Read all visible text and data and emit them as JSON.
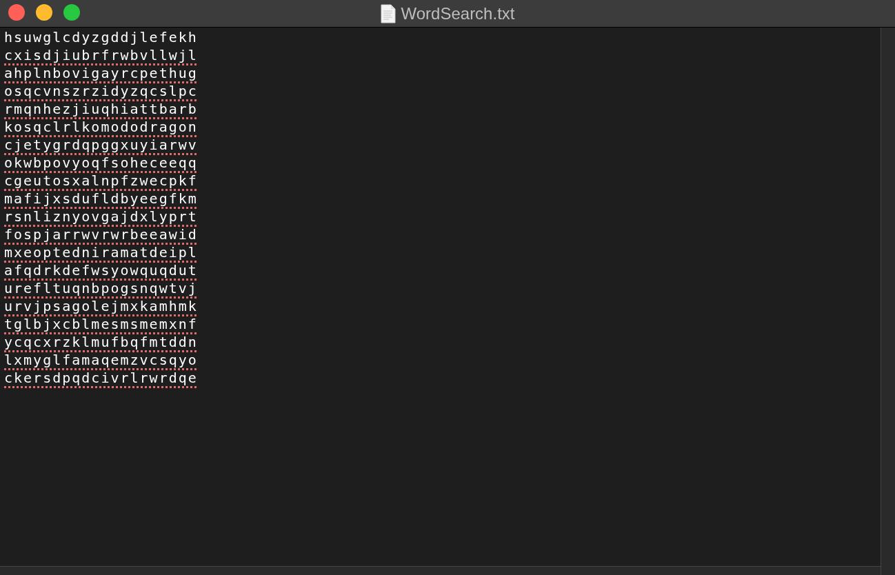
{
  "window": {
    "title": "WordSearch.txt"
  },
  "lines": [
    {
      "text": "hsuwglcdyzgddjlefekh",
      "misspelled": false
    },
    {
      "text": "cxisdjiubrfrwbvllwjl",
      "misspelled": true
    },
    {
      "text": "ahplnbovigayrcpethug",
      "misspelled": true
    },
    {
      "text": "osqcvnszrzidyzqcslpc",
      "misspelled": true
    },
    {
      "text": "rmqnhezjiuqhiattbarb",
      "misspelled": true
    },
    {
      "text": "kosqclrlkomododragon",
      "misspelled": true
    },
    {
      "text": "cjetygrdqpggxuyiarwv",
      "misspelled": true
    },
    {
      "text": "okwbpovyoqfsoheceeqq",
      "misspelled": true
    },
    {
      "text": "cgeutosxalnpfzwecpkf",
      "misspelled": true
    },
    {
      "text": "mafijxsdufldbyeegfkm",
      "misspelled": true
    },
    {
      "text": "rsnliznyovgajdxlyprt",
      "misspelled": true
    },
    {
      "text": "fospjarrwvrwrbeeawid",
      "misspelled": true
    },
    {
      "text": "mxeoptedniramatdeipl",
      "misspelled": true
    },
    {
      "text": "afqdrkdefwsyowquqdut",
      "misspelled": true
    },
    {
      "text": "urefltuqnbpogsnqwtvj",
      "misspelled": true
    },
    {
      "text": "urvjpsagolejmxkamhmk",
      "misspelled": true
    },
    {
      "text": "tglbjxcblmesmsmemxnf",
      "misspelled": true
    },
    {
      "text": "ycqcxrzklmufbqfmtddn",
      "misspelled": true
    },
    {
      "text": "lxmyglfamaqemzvcsqyo",
      "misspelled": true
    },
    {
      "text": "ckersdpqdcivrlrwrdqe",
      "misspelled": true
    }
  ]
}
